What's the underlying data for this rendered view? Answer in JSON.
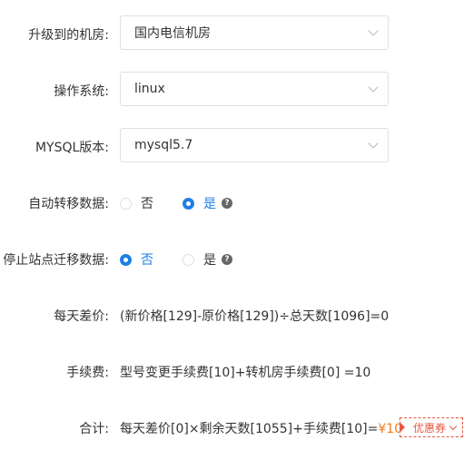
{
  "room": {
    "label": "升级到的机房:",
    "value": "国内电信机房"
  },
  "os": {
    "label": "操作系统:",
    "value": "linux"
  },
  "mysql": {
    "label": "MYSQL版本:",
    "value": "mysql5.7"
  },
  "auto_migrate": {
    "label": "自动转移数据:",
    "options": [
      {
        "label": "否",
        "checked": false
      },
      {
        "label": "是",
        "checked": true
      }
    ],
    "help_icon": "question-circle-icon"
  },
  "stop_site": {
    "label": "停止站点迁移数据:",
    "options": [
      {
        "label": "否",
        "checked": true
      },
      {
        "label": "是",
        "checked": false
      }
    ],
    "help_icon": "question-circle-icon"
  },
  "daily_diff": {
    "label": "每天差价:",
    "formula": "(新价格[129]-原价格[129])÷总天数[1096]=0"
  },
  "fee": {
    "label": "手续费:",
    "formula": "型号变更手续费[10]+转机房手续费[0] =10"
  },
  "total": {
    "label": "合计:",
    "formula": "每天差价[0]×剩余天数[1055]+手续费[10]=",
    "price": "¥10"
  },
  "coupon": {
    "label": "优惠券"
  },
  "colors": {
    "primary": "#1f7fe5",
    "price": "#f07d1a",
    "coupon": "#e9573f"
  }
}
